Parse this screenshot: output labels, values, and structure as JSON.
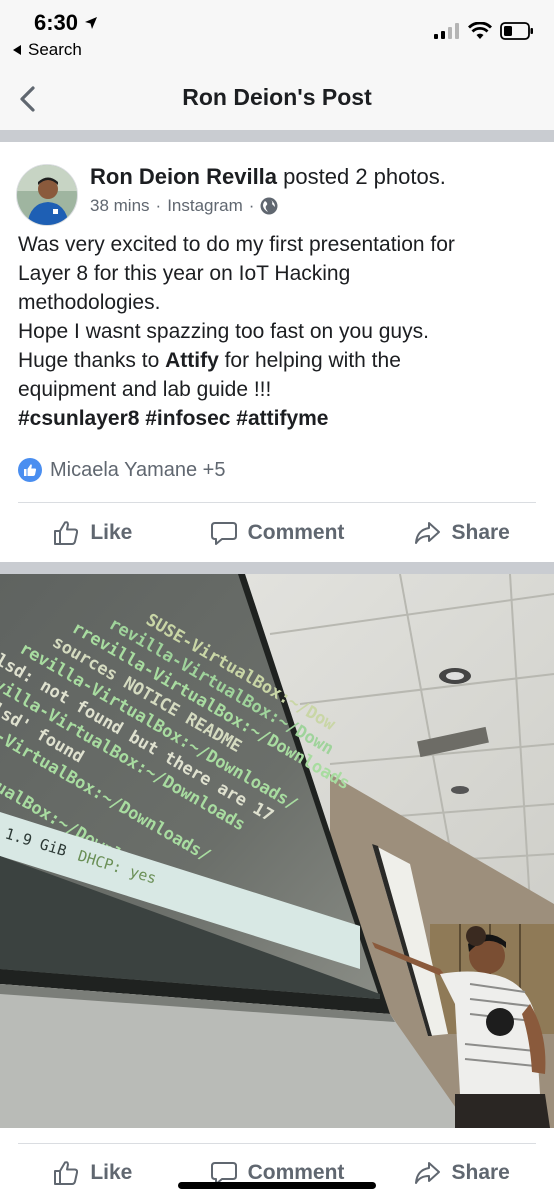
{
  "status_bar": {
    "time": "6:30",
    "back_app": "Search"
  },
  "nav": {
    "title": "Ron Deion's Post"
  },
  "post": {
    "author": "Ron Deion Revilla",
    "action": "posted 2 photos.",
    "time_ago": "38 mins",
    "separator": "·",
    "source": "Instagram",
    "separator2": "·",
    "text_lines": [
      "Was very excited to do my first presentation for",
      "Layer 8 for this year on IoT Hacking",
      "methodologies.",
      "Hope I wasnt spazzing too fast on you guys.",
      "Huge thanks to ",
      "Attify",
      " for helping with  the",
      "equipment and lab guide !!!",
      "#csunlayer8 #infosec #attifyme"
    ],
    "reactions_text": "Micaela Yamane +5"
  },
  "actions": {
    "like": "Like",
    "comment": "Comment",
    "share": "Share"
  },
  "photo": {
    "screen_lines": [
      "SUSE-VirtualBox:~/Dow",
      "revilla-VirtualBox:~/Down",
      "rrevilla-VirtualBox:~/Downloads",
      "sources NOTICE README",
      "revilla-VirtualBox:~/Downloads/",
      "lsd: not found but there are 17",
      "rrevilla-VirtualBox:~/Downloads",
      "and 'lsd' found",
      "rrevilla-VirtualBox:~/Downloads/",
      "sources",
      "rrevilla-VirtualBox:~/Downloads/"
    ],
    "status_text": "1.9 GiB",
    "dhcp_text": "DHCP: yes"
  },
  "icons": {
    "location_arrow": "location-arrow-icon",
    "back_chevron": "chevron-left-icon",
    "globe": "globe-icon",
    "like": "thumbs-up-icon",
    "comment": "comment-bubble-icon",
    "share": "share-arrow-icon"
  },
  "colors": {
    "fb_blue": "#4a8ef0",
    "meta_gray": "#606770",
    "separator_gray": "#c9ccd1"
  }
}
